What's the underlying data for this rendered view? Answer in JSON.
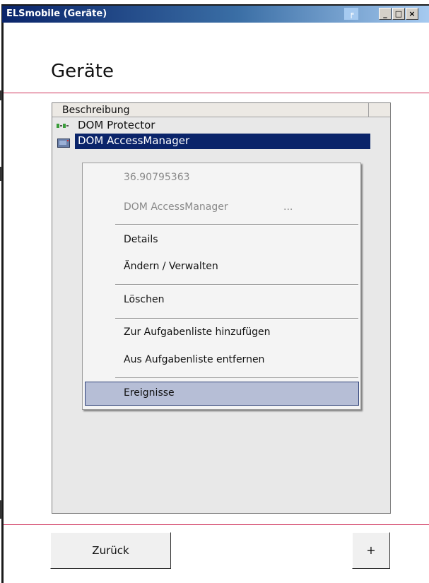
{
  "window": {
    "title": "ELSmobile (Geräte)",
    "controls": {
      "minimize": "_",
      "maximize": "□",
      "close": "×"
    }
  },
  "page": {
    "heading": "Geräte"
  },
  "list": {
    "column_header": "Beschreibung",
    "items": [
      {
        "label": "DOM Protector",
        "icon": "device-green-icon",
        "selected": false
      },
      {
        "label": "DOM AccessManager",
        "icon": "device-monitor-icon",
        "selected": true
      }
    ]
  },
  "context_menu": {
    "info_value": "36.90795363",
    "info_name": "DOM AccessManager",
    "info_ellipsis": "...",
    "items": [
      "Details",
      "Ändern / Verwalten",
      "Löschen",
      "Zur Aufgabenliste hinzufügen",
      "Aus Aufgabenliste entfernen",
      "Ereignisse"
    ],
    "highlighted": "Ereignisse"
  },
  "buttons": {
    "back": "Zurück",
    "add": "+"
  },
  "colors": {
    "accent_line": "#d0335c",
    "selection": "#0a246a",
    "titlebar": "#0a246a"
  }
}
